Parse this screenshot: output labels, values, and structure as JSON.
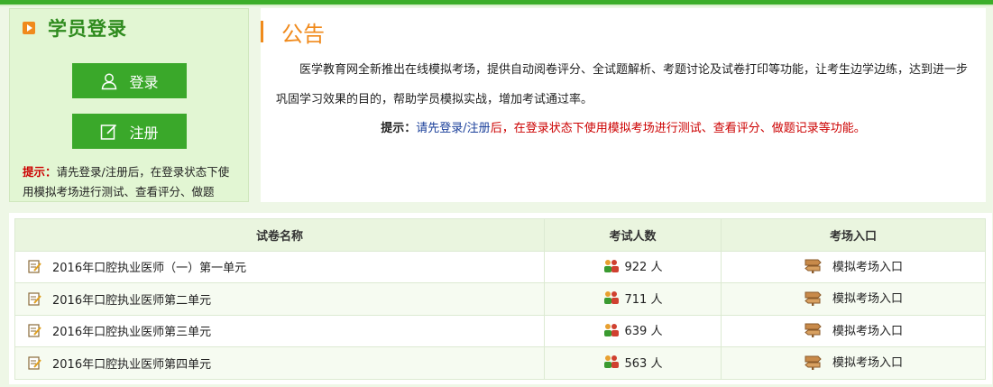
{
  "login": {
    "title": "学员登录",
    "login_label": "登录",
    "register_label": "注册",
    "tip_label": "提示：",
    "tip_text": "请先登录/注册后，在登录状态下使用模拟考场进行测试、查看评分、做题"
  },
  "notice": {
    "title": "公告",
    "body": "医学教育网全新推出在线模拟考场，提供自动阅卷评分、全试题解析、考题讨论及试卷打印等功能，让考生边学边练，达到进一步巩固学习效果的目的，帮助学员模拟实战，增加考试通过率。",
    "tip_label": "提示：",
    "tip_link": "请先登录/注册",
    "tip_text": "后，在登录状态下使用模拟考场进行测试、查看评分、做题记录等功能。"
  },
  "table": {
    "headers": [
      "试卷名称",
      "考试人数",
      "考场入口"
    ],
    "rows": [
      {
        "name": "2016年口腔执业医师（一）第一单元",
        "count": "922 人",
        "entry": "模拟考场入口"
      },
      {
        "name": "2016年口腔执业医师第二单元",
        "count": "711 人",
        "entry": "模拟考场入口"
      },
      {
        "name": "2016年口腔执业医师第三单元",
        "count": "639 人",
        "entry": "模拟考场入口"
      },
      {
        "name": "2016年口腔执业医师第四单元",
        "count": "563 人",
        "entry": "模拟考场入口"
      }
    ]
  },
  "icons": {
    "login": "user-icon",
    "register": "edit-icon",
    "paper": "paper-edit-icon",
    "count": "people-icon",
    "entry": "signpost-icon"
  },
  "colors": {
    "brand_green": "#3aa82a",
    "accent_orange": "#f08a1c",
    "tip_red": "#cc0000",
    "link_blue": "#1a3f9a"
  }
}
